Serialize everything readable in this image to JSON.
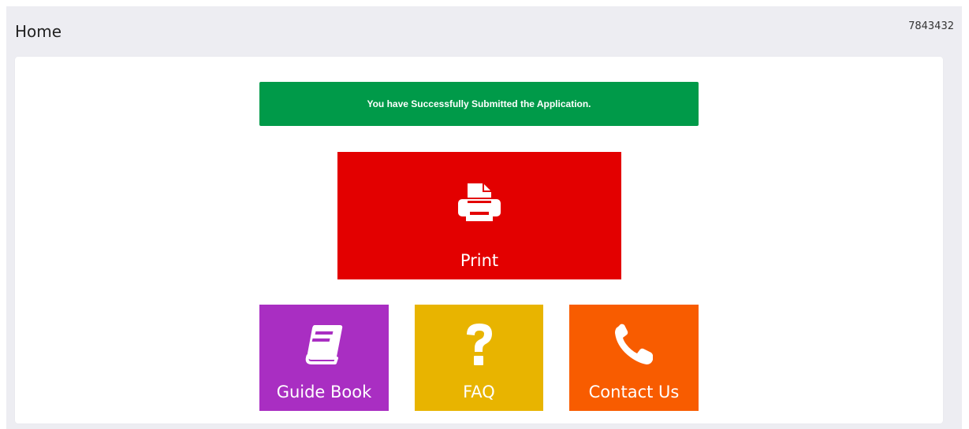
{
  "header": {
    "title": "Home",
    "reference": "7843432"
  },
  "alert": {
    "message": "You have Successfully Submitted the Application.",
    "color": "#009a49"
  },
  "tiles": {
    "print": {
      "label": "Print",
      "icon": "printer-icon",
      "color": "#e30000"
    },
    "guide": {
      "label": "Guide Book",
      "icon": "book-icon",
      "color": "#a92ec2"
    },
    "faq": {
      "label": "FAQ",
      "icon": "question-mark-icon",
      "color": "#e8b400"
    },
    "contact": {
      "label": "Contact Us",
      "icon": "phone-icon",
      "color": "#f85c00"
    }
  }
}
